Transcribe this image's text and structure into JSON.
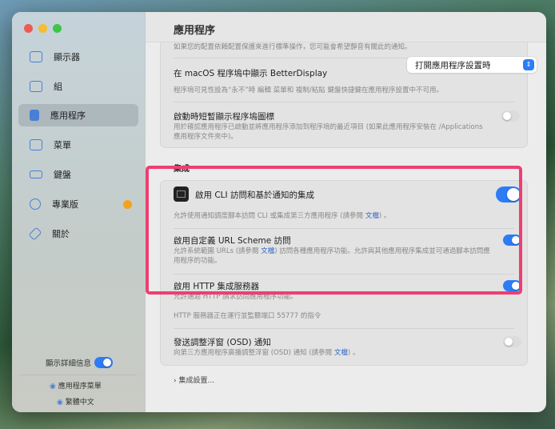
{
  "window": {
    "title": "應用程序"
  },
  "sidebar": {
    "items": [
      {
        "label": "顯示器",
        "icon": "display-icon"
      },
      {
        "label": "組",
        "icon": "group-icon"
      },
      {
        "label": "應用程序",
        "icon": "app-icon",
        "selected": true
      },
      {
        "label": "菜單",
        "icon": "menu-icon"
      },
      {
        "label": "鍵盤",
        "icon": "keyboard-icon"
      },
      {
        "label": "專業版",
        "icon": "pro-icon",
        "badge": true
      },
      {
        "label": "關於",
        "icon": "tag-icon"
      }
    ],
    "show_details_label": "顯示詳細信息",
    "show_details_on": true,
    "app_menu_label": "應用程序菜單",
    "language_label": "繁體中文"
  },
  "general": {
    "top_note": "如果您的配置依賴配置保護來進行標準操作，您可能會希望靜音有關此的通知。",
    "dock_label": "在 macOS 程序塢中顯示 BetterDisplay",
    "dock_value": "打開應用程序設置時",
    "dock_desc": "程序塢可見性設為“永不”時 編輯 菜單和 複制/粘貼 鍵盤快捷鍵在應用程序設置中不可用。",
    "flash_label": "啟動時短暫顯示程序塢圖標",
    "flash_on": false,
    "flash_desc1": "用於確認應用程序已啟動並將應用程序添加到程序塢的最近項目 (如果此應用程序安裝在 /Applications",
    "flash_desc2": "應用程序文件夾中)。"
  },
  "integration": {
    "header": "集成",
    "cli_label": "啟用 CLI 訪問和基於通知的集成",
    "cli_on": true,
    "cli_desc": "允許使用通知調度腳本訪問 CLI 或集成第三方應用程序 (請參閱",
    "doc_link": "文檔",
    "url_label": "啟用自定義 URL Scheme 訪問",
    "url_on": true,
    "url_desc1a": "允許系統範圍 URLs (請參閱",
    "url_desc1b": ") 訪問各種應用程序功能。允許與其他應用程序集成並可通過腳本訪問應",
    "url_desc2": "用程序的功能。",
    "http_label": "啟用 HTTP 集成服務器",
    "http_on": true,
    "http_desc": "允許通過 HTTP 請求訪問應用程序功能。",
    "http_status": "HTTP 服務器正在運行並監聽端口 55777 的指令",
    "osd_label": "發送調整浮窗 (OSD) 通知",
    "osd_on": false,
    "osd_desc": "向第三方應用程序廣播調整浮窗 (OSD) 通知 (請參閱",
    "end_punct": "。",
    "settings_link": "集成設置..."
  }
}
